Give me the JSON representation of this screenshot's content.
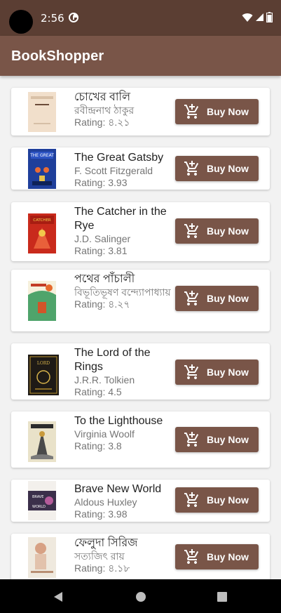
{
  "status_bar": {
    "time": "2:56",
    "icons": [
      "app-notification-icon",
      "wifi-icon",
      "cell-signal-icon",
      "battery-icon"
    ]
  },
  "app_bar": {
    "title": "BookShopper"
  },
  "colors": {
    "status_bar": "#5b3e33",
    "app_bar": "#795548",
    "button": "#795548",
    "background": "#f2f2f2"
  },
  "books": [
    {
      "title": "চোখের বালি",
      "author": "রবীন্দ্রনাথ ঠাকুর",
      "rating": "Rating: ৪.২১",
      "button": "Buy Now"
    },
    {
      "title": "The Great Gatsby",
      "author": "F. Scott Fitzgerald",
      "rating": "Rating: 3.93",
      "button": "Buy Now"
    },
    {
      "title": "The Catcher in the Rye",
      "author": "J.D. Salinger",
      "rating": "Rating: 3.81",
      "button": "Buy Now"
    },
    {
      "title": "পথের পাঁচালী",
      "author": "বিভূতিভূষণ বন্দ্যোপাধ্যায়",
      "rating": "Rating: ৪.২৭",
      "button": "Buy Now"
    },
    {
      "title": "The Lord of the Rings",
      "author": "J.R.R. Tolkien",
      "rating": "Rating: 4.5",
      "button": "Buy Now"
    },
    {
      "title": "To the Lighthouse",
      "author": "Virginia Woolf",
      "rating": "Rating: 3.8",
      "button": "Buy Now"
    },
    {
      "title": "Brave New World",
      "author": "Aldous Huxley",
      "rating": "Rating: 3.98",
      "button": "Buy Now"
    },
    {
      "title": "ফেলুদা সিরিজ",
      "author": "সত্যজিৎ রায়",
      "rating": "Rating: ৪.১৮",
      "button": "Buy Now"
    }
  ],
  "nav_bar": {
    "icons": [
      "back-icon",
      "home-icon",
      "recents-icon"
    ]
  }
}
